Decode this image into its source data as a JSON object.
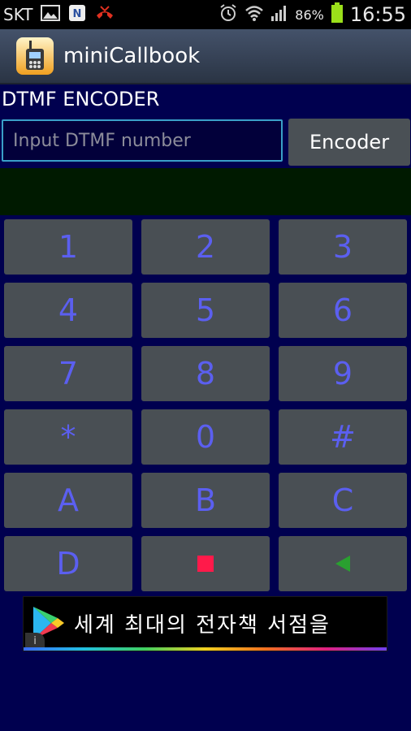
{
  "status_bar": {
    "carrier": "SKT",
    "battery_percent": "86%",
    "time": "16:55",
    "icons": [
      "gallery-icon",
      "n-badge-icon",
      "missed-call-icon",
      "alarm-icon",
      "wifi-icon",
      "signal-icon",
      "battery-icon"
    ]
  },
  "app": {
    "title": "miniCallbook",
    "icon": "walkie-talkie-icon"
  },
  "dtmf": {
    "section_title": "DTMF ENCODER",
    "input_placeholder": "Input DTMF number",
    "input_value": "",
    "encoder_label": "Encoder"
  },
  "keypad": {
    "rows": [
      [
        "1",
        "2",
        "3"
      ],
      [
        "4",
        "5",
        "6"
      ],
      [
        "7",
        "8",
        "9"
      ],
      [
        "*",
        "0",
        "#"
      ],
      [
        "A",
        "B",
        "C"
      ],
      [
        "D",
        "stop",
        "play"
      ]
    ],
    "key_color": "#5b5ff0",
    "stop_color": "#ff1a4a",
    "play_color": "#2aa030"
  },
  "ad": {
    "text": "세계 최대의 전자책 서점을",
    "icon": "google-play-icon"
  },
  "colors": {
    "background": "#00004f",
    "key_background": "#494f54",
    "input_border": "#3aa0c8"
  }
}
